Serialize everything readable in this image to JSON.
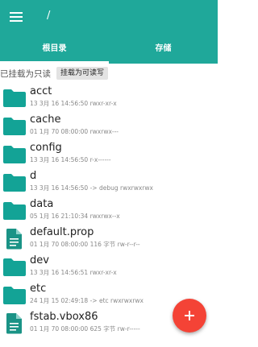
{
  "header": {
    "path": "/",
    "menu_icon": "hamburger-menu-icon"
  },
  "tabs": [
    {
      "label": "根目录",
      "active": true
    },
    {
      "label": "存储",
      "active": false
    }
  ],
  "mount": {
    "status": "已挂载为只读",
    "button_label": "挂载为可读写"
  },
  "files": [
    {
      "name": "acct",
      "meta": "13 3月 16 14:56:50   rwxr-xr-x",
      "type": "folder"
    },
    {
      "name": "cache",
      "meta": "01 1月 70 08:00:00   rwxrwx---",
      "type": "folder"
    },
    {
      "name": "config",
      "meta": "13 3月 16 14:56:50   r-x------",
      "type": "folder"
    },
    {
      "name": "d",
      "meta": "13 3月 16 14:56:50   -> debug  rwxrwxrwx",
      "type": "folder"
    },
    {
      "name": "data",
      "meta": "05 1月 16 21:10:34   rwxrwx--x",
      "type": "folder"
    },
    {
      "name": "default.prop",
      "meta": "01 1月 70 08:00:00   116 字节   rw-r--r--",
      "type": "file"
    },
    {
      "name": "dev",
      "meta": "13 3月 16 14:56:51   rwxr-xr-x",
      "type": "folder"
    },
    {
      "name": "etc",
      "meta": "24 1月 15 02:49:18   -> etc  rwxrwxrwx",
      "type": "folder"
    },
    {
      "name": "fstab.vbox86",
      "meta": "01 1月 70 08:00:00   625 字节   rw-r-----",
      "type": "file"
    }
  ],
  "fab_icon": "plus-icon",
  "colors": {
    "primary": "#1fa89a",
    "folder": "#13a396",
    "file": "#1a9386",
    "fab": "#f44336"
  }
}
